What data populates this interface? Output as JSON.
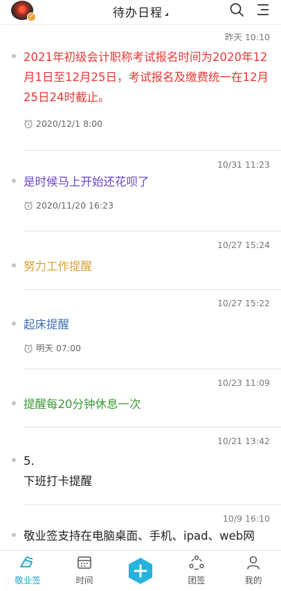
{
  "header": {
    "title": "待办日程",
    "avatar_badge": "✓",
    "icons": {
      "search": "search-icon",
      "menu": "menu-icon",
      "dropdown": "caret-icon"
    }
  },
  "colors": {
    "red": "#e53935",
    "purple": "#6b44c9",
    "gold": "#d9a234",
    "blue": "#3d6fb0",
    "green": "#3a9a35",
    "default": "#222222",
    "accent": "#26a0c4"
  },
  "todos": [
    {
      "time": "昨天  10:10",
      "text": "2021年初级会计职称考试报名时间为2020年12月1日至12月25日，考试报名及缴费统一在12月25日24时截止。",
      "color": "red",
      "remind": "2020/12/1 8:00"
    },
    {
      "time": "10/31 11:23",
      "text": "是时候马上开始还花呗了",
      "color": "purple",
      "remind": "2020/11/20 16:23"
    },
    {
      "time": "10/27 15:24",
      "text": "努力工作提醒",
      "color": "gold",
      "remind": ""
    },
    {
      "time": "10/27 15:22",
      "text": "起床提醒",
      "color": "blue",
      "remind": "明天 07:00"
    },
    {
      "time": "10/23 11:09",
      "text": "提醒每20分钟休息一次",
      "color": "green",
      "remind": ""
    },
    {
      "time": "10/21 13:42",
      "text": "5.\n下班打卡提醒",
      "color": "default",
      "remind": ""
    },
    {
      "time": "10/9 16:10",
      "text": "敬业签支持在电脑桌面、手机、ipad、web网",
      "color": "default",
      "remind": ""
    }
  ],
  "tabbar": {
    "items": [
      {
        "label": "敬业签",
        "icon": "sign-icon",
        "active": true
      },
      {
        "label": "时间",
        "icon": "calendar-icon",
        "active": false
      },
      {
        "label": "",
        "icon": "add-icon",
        "active": false
      },
      {
        "label": "团签",
        "icon": "team-icon",
        "active": false
      },
      {
        "label": "我的",
        "icon": "profile-icon",
        "active": false
      }
    ]
  }
}
